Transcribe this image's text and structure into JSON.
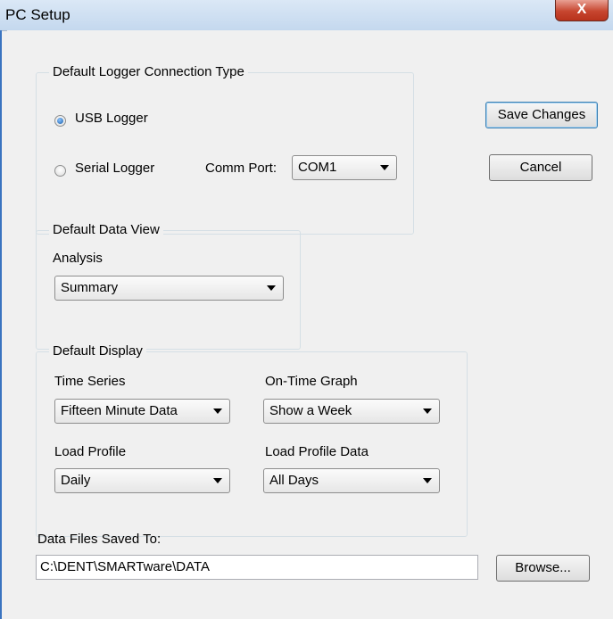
{
  "window": {
    "title": "PC Setup",
    "close_label": "X"
  },
  "connection_group": {
    "legend": "Default Logger Connection Type",
    "usb_label": "USB Logger",
    "serial_label": "Serial Logger",
    "selected": "USB Logger",
    "comm_port_label": "Comm Port:",
    "comm_port_value": "COM1"
  },
  "buttons": {
    "save": "Save Changes",
    "cancel": "Cancel",
    "browse": "Browse..."
  },
  "data_view_group": {
    "legend": "Default Data View",
    "analysis_label": "Analysis",
    "analysis_value": "Summary"
  },
  "display_group": {
    "legend": "Default Display",
    "time_series_label": "Time Series",
    "time_series_value": "Fifteen Minute Data",
    "on_time_label": "On-Time Graph",
    "on_time_value": "Show a Week",
    "load_profile_label": "Load Profile",
    "load_profile_value": "Daily",
    "load_profile_data_label": "Load Profile Data",
    "load_profile_data_value": "All Days"
  },
  "data_files": {
    "label": "Data Files Saved To:",
    "path": "C:\\DENT\\SMARTware\\DATA"
  }
}
